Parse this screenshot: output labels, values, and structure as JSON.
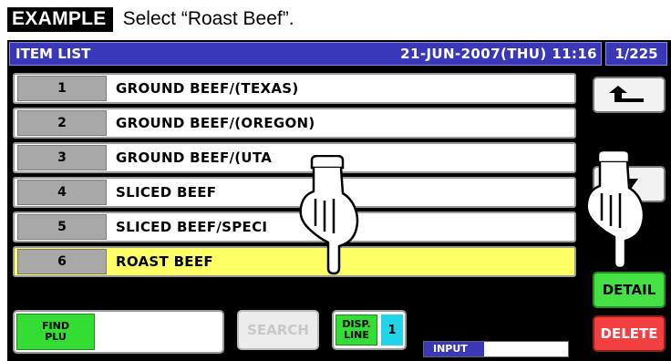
{
  "caption": {
    "tag": "EXAMPLE",
    "text": "Select “Roast Beef”."
  },
  "header": {
    "title": "ITEM LIST",
    "datetime": "21-JUN-2007(THU) 11:16",
    "page": "1/225"
  },
  "items": [
    {
      "num": "1",
      "name": "GROUND BEEF/(TEXAS)",
      "selected": false
    },
    {
      "num": "2",
      "name": "GROUND BEEF/(OREGON)",
      "selected": false
    },
    {
      "num": "3",
      "name": "GROUND BEEF/(UTA",
      "selected": false
    },
    {
      "num": "4",
      "name": "SLICED BEEF",
      "selected": false
    },
    {
      "num": "5",
      "name": "SLICED BEEF/SPECI",
      "selected": false
    },
    {
      "num": "6",
      "name": "ROAST BEEF",
      "selected": true
    }
  ],
  "buttons": {
    "up_icon": "arrow-up-left-icon",
    "down_icon": "arrow-down-icon",
    "detail": "DETAIL",
    "delete": "DELETE",
    "find_plu_line1": "FIND",
    "find_plu_line2": "PLU",
    "search": "SEARCH",
    "disp_line_line1": "DISP.",
    "disp_line_line2": "LINE",
    "disp_line_value": "1",
    "input": "INPUT"
  },
  "colors": {
    "titlebar": "#3838b8",
    "selected_row": "#ffff66",
    "detail": "#44e044",
    "delete": "#f24040",
    "green_label": "#33dd33",
    "cyan_value": "#22d4e8"
  }
}
